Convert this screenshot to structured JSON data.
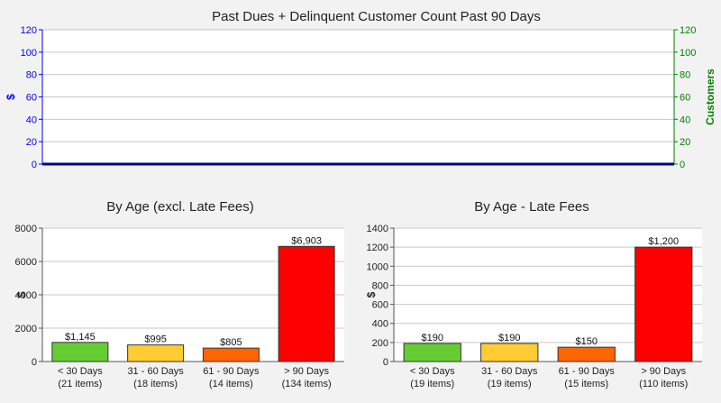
{
  "chart_data": [
    {
      "type": "line",
      "title": "Past Dues + Delinquent Customer Count Past 90 Days",
      "ylabel": "$",
      "y2label": "Customers",
      "ylim": [
        0,
        120
      ],
      "y2lim": [
        0,
        120
      ],
      "yticks": [
        0,
        20,
        40,
        60,
        80,
        100,
        120
      ],
      "y2ticks": [
        0,
        20,
        40,
        60,
        80,
        100,
        120
      ],
      "series": [
        {
          "values": [
            0,
            0
          ],
          "color": "#00008b"
        }
      ],
      "colors": {
        "left_axis": "#0000ff",
        "right_axis": "#008000"
      },
      "grid": true
    },
    {
      "type": "bar",
      "title": "By Age (excl. Late Fees)",
      "ylabel": "$",
      "ylim": [
        0,
        8000
      ],
      "yticks": [
        0,
        2000,
        4000,
        6000,
        8000
      ],
      "categories": [
        "< 30 Days",
        "31 - 60 Days",
        "61 - 90 Days",
        "> 90 Days"
      ],
      "category_sub": [
        "(21 items)",
        "(18 items)",
        "(14 items)",
        "(134 items)"
      ],
      "values": [
        1145,
        995,
        805,
        6903
      ],
      "data_labels": [
        "$1,145",
        "$995",
        "$805",
        "$6,903"
      ],
      "colors": [
        "#66cc33",
        "#ffcc33",
        "#ff6600",
        "#ff0000"
      ],
      "grid": true
    },
    {
      "type": "bar",
      "title": "By Age - Late Fees",
      "ylabel": "$",
      "ylim": [
        0,
        1400
      ],
      "yticks": [
        0,
        200,
        400,
        600,
        800,
        1000,
        1200,
        1400
      ],
      "categories": [
        "< 30 Days",
        "31 - 60 Days",
        "61 - 90 Days",
        "> 90 Days"
      ],
      "category_sub": [
        "(19 items)",
        "(19 items)",
        "(15 items)",
        "(110 items)"
      ],
      "values": [
        190,
        190,
        150,
        1200
      ],
      "data_labels": [
        "$190",
        "$190",
        "$150",
        "$1,200"
      ],
      "colors": [
        "#66cc33",
        "#ffcc33",
        "#ff6600",
        "#ff0000"
      ],
      "grid": true
    }
  ]
}
